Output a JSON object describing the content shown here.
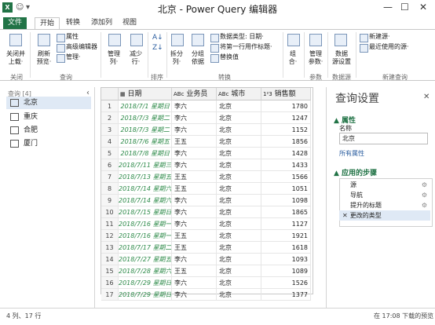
{
  "window": {
    "title": "北京 - Power Query 编辑器",
    "minimize": "—",
    "maximize": "☐",
    "close": "✕"
  },
  "tabs": [
    "文件",
    "开始",
    "转换",
    "添加列",
    "视图"
  ],
  "ribbon": {
    "close_group": {
      "btn1": "关闭并",
      "btn1b": "上载·",
      "label": "关闭"
    },
    "query_group": {
      "refresh": "刷新",
      "refreshb": "预览·",
      "properties": "属性",
      "advanced": "高级编辑器",
      "manage": "管理·",
      "label": "查询"
    },
    "columns_group": {
      "manage": "管理",
      "manageb": "列·",
      "reduce": "减少",
      "reduceb": "行·",
      "label": ""
    },
    "sort_group": {
      "label": "排序"
    },
    "transform_group": {
      "split": "拆分",
      "splitb": "列·",
      "group": "分组",
      "groupb": "依据",
      "datatype": "数据类型: 日期·",
      "firstrow": "将第一行用作标题·",
      "replace": "替换值",
      "label": "转换"
    },
    "combine_group": {
      "combine": "组",
      "combineb": "合·",
      "label": ""
    },
    "params_group": {
      "manage": "管理",
      "manageb": "参数·",
      "label": "参数"
    },
    "source_group": {
      "settings": "数据",
      "settingsb": "源设置",
      "label": "数据源"
    },
    "newquery_group": {
      "newsource": "新建源·",
      "recent": "最近使用的源·",
      "label": "新建查询"
    }
  },
  "queries": {
    "header": "查询 [4]",
    "collapse": "‹",
    "items": [
      "北京",
      "重庆",
      "合肥",
      "厦门"
    ]
  },
  "grid": {
    "columns": [
      {
        "type": "▦",
        "name": "日期"
      },
      {
        "type": "ABc",
        "name": "业务员"
      },
      {
        "type": "ABc",
        "name": "城市"
      },
      {
        "type": "1²3",
        "name": "销售额"
      }
    ],
    "rows": [
      [
        "1",
        "2018/7/1 星期日",
        "李六",
        "北京",
        "1780"
      ],
      [
        "2",
        "2018/7/3 星期二",
        "李六",
        "北京",
        "1247"
      ],
      [
        "3",
        "2018/7/3 星期二",
        "李六",
        "北京",
        "1152"
      ],
      [
        "4",
        "2018/7/6 星期五",
        "王五",
        "北京",
        "1856"
      ],
      [
        "5",
        "2018/7/8 星期日",
        "李六",
        "北京",
        "1428"
      ],
      [
        "6",
        "2018/7/11 星期三",
        "李六",
        "北京",
        "1433"
      ],
      [
        "7",
        "2018/7/13 星期五",
        "王五",
        "北京",
        "1566"
      ],
      [
        "8",
        "2018/7/14 星期六",
        "王五",
        "北京",
        "1051"
      ],
      [
        "9",
        "2018/7/14 星期六",
        "李六",
        "北京",
        "1098"
      ],
      [
        "10",
        "2018/7/15 星期日",
        "李六",
        "北京",
        "1865"
      ],
      [
        "11",
        "2018/7/16 星期一",
        "李六",
        "北京",
        "1127"
      ],
      [
        "12",
        "2018/7/16 星期一",
        "王五",
        "北京",
        "1921"
      ],
      [
        "13",
        "2018/7/17 星期二",
        "王五",
        "北京",
        "1618"
      ],
      [
        "14",
        "2018/7/27 星期五",
        "李六",
        "北京",
        "1093"
      ],
      [
        "15",
        "2018/7/28 星期六",
        "王五",
        "北京",
        "1089"
      ],
      [
        "16",
        "2018/7/29 星期日",
        "李六",
        "北京",
        "1526"
      ],
      [
        "17",
        "2018/7/29 星期日",
        "李六",
        "北京",
        "1377"
      ]
    ]
  },
  "settings": {
    "title": "查询设置",
    "close": "✕",
    "props_header": "▲ 属性",
    "name_label": "名称",
    "name_value": "北京",
    "all_props": "所有属性",
    "steps_header": "▲ 应用的步骤",
    "steps": [
      "源",
      "导航",
      "提升的标题",
      "更改的类型"
    ],
    "gear": "⚙"
  },
  "status": {
    "left": "4 列、17 行",
    "right": "在 17:08 下载的预览"
  }
}
